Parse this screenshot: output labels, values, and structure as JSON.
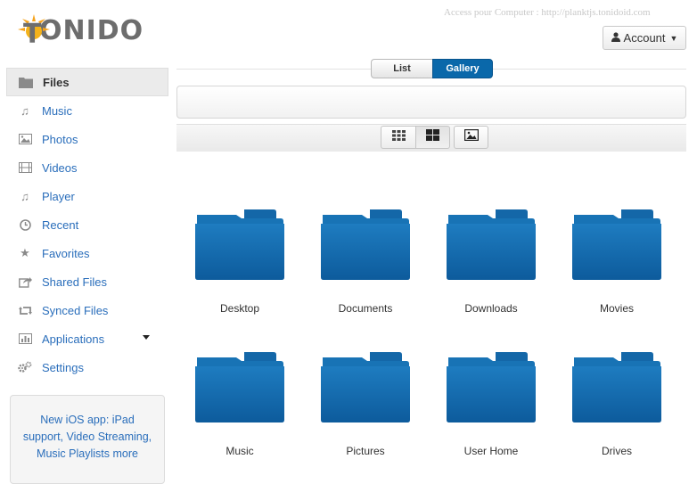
{
  "header": {
    "logo_text": "ONIDO",
    "logo_letter": "T",
    "access_text": "Access pour Computer : http://planktjs.tonidoid.com",
    "account_label": "Account"
  },
  "sidebar": {
    "items": [
      {
        "label": "Files",
        "icon": "folder-icon"
      },
      {
        "label": "Music",
        "icon": "music-icon"
      },
      {
        "label": "Photos",
        "icon": "photo-icon"
      },
      {
        "label": "Videos",
        "icon": "film-icon"
      },
      {
        "label": "Player",
        "icon": "music-icon"
      },
      {
        "label": "Recent",
        "icon": "clock-icon"
      },
      {
        "label": "Favorites",
        "icon": "star-icon"
      },
      {
        "label": "Shared Files",
        "icon": "share-icon"
      },
      {
        "label": "Synced Files",
        "icon": "sync-icon"
      },
      {
        "label": "Applications",
        "icon": "chart-icon"
      },
      {
        "label": "Settings",
        "icon": "gears-icon"
      }
    ],
    "promo": "New iOS app: iPad support, Video Streaming, Music Playlists more"
  },
  "view_toggle": {
    "list": "List",
    "gallery": "Gallery",
    "active": "gallery"
  },
  "toolbar": {
    "buttons": [
      "grid-small-icon",
      "grid-large-icon",
      "image-icon"
    ],
    "active": "grid-large-icon"
  },
  "folders": [
    {
      "name": "Desktop"
    },
    {
      "name": "Documents"
    },
    {
      "name": "Downloads"
    },
    {
      "name": "Movies"
    },
    {
      "name": "Music"
    },
    {
      "name": "Pictures"
    },
    {
      "name": "User Home"
    },
    {
      "name": "Drives"
    }
  ],
  "colors": {
    "accent": "#0a68aa",
    "link": "#2a6ebb",
    "folder": "#1468ad"
  }
}
